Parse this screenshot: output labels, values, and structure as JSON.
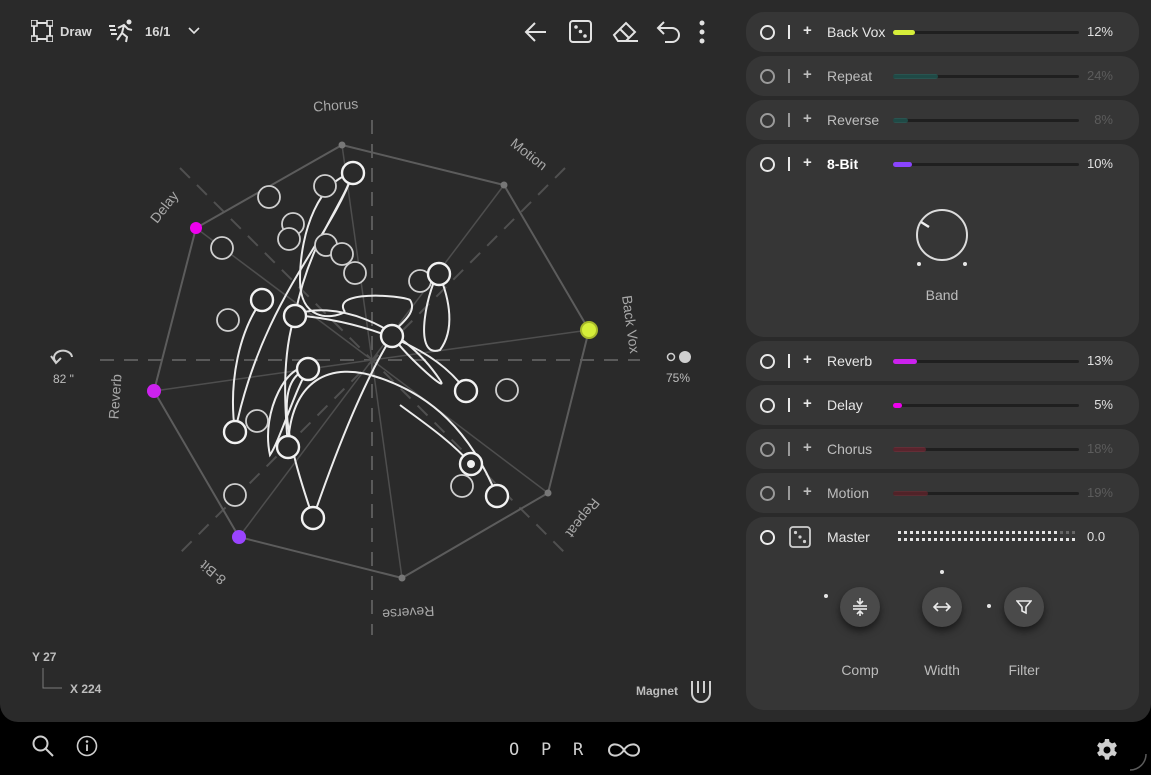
{
  "toolbar": {
    "draw_label": "Draw",
    "division": "16/1"
  },
  "canvas": {
    "axes": [
      "Chorus",
      "Motion",
      "Back Vox",
      "Repeat",
      "Reverse",
      "8-Bit",
      "Reverb",
      "Delay"
    ],
    "rotation": "82 \"",
    "amount": "75%",
    "y_readout": "Y 27",
    "x_readout": "X 224",
    "magnet_label": "Magnet",
    "colors": {
      "delay": "#ee00ee",
      "reverb": "#cc22ee",
      "bit8": "#9a44ff",
      "backvox": "#d6ee3a"
    }
  },
  "effects": [
    {
      "name": "Back Vox",
      "value": "12%",
      "level": 0.12,
      "color": "#d6ee3a",
      "dim": false
    },
    {
      "name": "Repeat",
      "value": "24%",
      "level": 0.24,
      "color": "#1f6e66",
      "dim": true
    },
    {
      "name": "Reverse",
      "value": "8%",
      "level": 0.08,
      "color": "#1f6e66",
      "dim": true
    },
    {
      "name": "8-Bit",
      "value": "10%",
      "level": 0.1,
      "color": "#8a44ff",
      "dim": false
    },
    {
      "name": "Reverb",
      "value": "13%",
      "level": 0.13,
      "color": "#cc22ee",
      "dim": false
    },
    {
      "name": "Delay",
      "value": "5%",
      "level": 0.05,
      "color": "#ee00ee",
      "dim": false
    },
    {
      "name": "Chorus",
      "value": "18%",
      "level": 0.18,
      "color": "#8a2838",
      "dim": true
    },
    {
      "name": "Motion",
      "value": "19%",
      "level": 0.19,
      "color": "#7a2430",
      "dim": true
    }
  ],
  "bitcard": {
    "knob_label": "Band"
  },
  "master": {
    "label": "Master",
    "value": "0.0",
    "buttons": [
      "Comp",
      "Width",
      "Filter"
    ]
  },
  "bottom": {
    "letters": [
      "O",
      "P",
      "R"
    ]
  }
}
